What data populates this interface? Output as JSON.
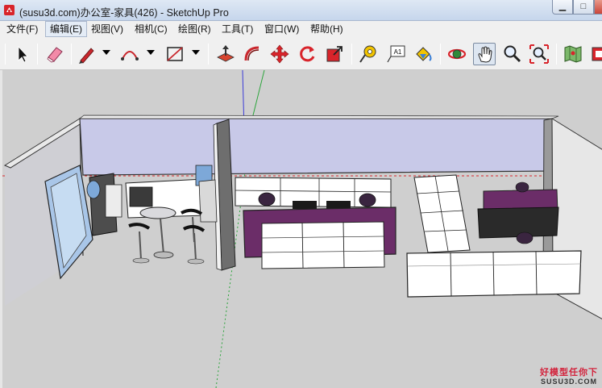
{
  "window": {
    "title": "(susu3d.com)办公室-家具(426) - SketchUp Pro",
    "minimize_glyph": "▁",
    "maximize_glyph": "□",
    "close_glyph": "",
    "icon": "sketchup-logo-icon"
  },
  "menu": [
    {
      "label": "文件(F)"
    },
    {
      "label": "编辑(E)"
    },
    {
      "label": "视图(V)"
    },
    {
      "label": "相机(C)"
    },
    {
      "label": "绘图(R)"
    },
    {
      "label": "工具(T)"
    },
    {
      "label": "窗口(W)"
    },
    {
      "label": "帮助(H)"
    }
  ],
  "active_menu": "编辑(E)",
  "toolbar": {
    "tools": [
      {
        "icon": "select-arrow-icon"
      },
      {
        "icon": "eraser-icon"
      },
      {
        "icon": "pencil-line-icon",
        "dropdown": true
      },
      {
        "icon": "arc-icon",
        "dropdown": true
      },
      {
        "icon": "rectangle-icon",
        "dropdown": true
      },
      {
        "icon": "push-pull-icon"
      },
      {
        "icon": "follow-me-icon"
      },
      {
        "icon": "move-icon"
      },
      {
        "icon": "rotate-icon"
      },
      {
        "icon": "scale-icon"
      },
      {
        "icon": "tape-measure-icon"
      },
      {
        "icon": "text-label-icon",
        "text": "A1"
      },
      {
        "icon": "paint-bucket-icon"
      },
      {
        "icon": "orbit-icon"
      },
      {
        "icon": "pan-hand-icon",
        "pressed": true
      },
      {
        "icon": "zoom-icon"
      },
      {
        "icon": "zoom-extents-icon"
      },
      {
        "icon": "map-icon"
      },
      {
        "icon": "add-location-icon"
      }
    ]
  },
  "colors": {
    "accent_red": "#d2233c",
    "wall_lavender": "#c8c9e8",
    "floor_gray": "#cfcfcf",
    "desk_purple": "#6b2d68",
    "furniture_white": "#ffffff"
  },
  "watermark": {
    "top": "好模型任你下",
    "bottom": "SUSU3D.COM"
  }
}
